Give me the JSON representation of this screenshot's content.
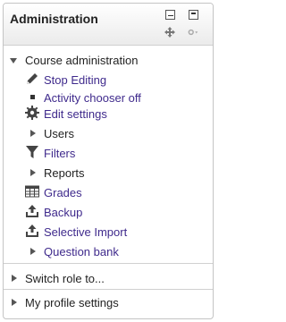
{
  "block": {
    "title": "Administration",
    "header_icons": [
      "minimize-icon",
      "dock-icon",
      "move-icon",
      "gear-icon"
    ]
  },
  "course_admin": {
    "label": "Course administration",
    "items": [
      {
        "label": "Stop Editing",
        "icon": "pencil-icon",
        "type": "link"
      },
      {
        "label": "Activity chooser off",
        "icon": "bullet-icon",
        "type": "link"
      },
      {
        "label": "Edit settings",
        "icon": "gear-icon",
        "type": "link"
      },
      {
        "label": "Users",
        "icon": "expand-arrow-icon",
        "type": "branch"
      },
      {
        "label": "Filters",
        "icon": "filter-icon",
        "type": "link"
      },
      {
        "label": "Reports",
        "icon": "expand-arrow-icon",
        "type": "branch"
      },
      {
        "label": "Grades",
        "icon": "grades-table-icon",
        "type": "link"
      },
      {
        "label": "Backup",
        "icon": "backup-upload-icon",
        "type": "link"
      },
      {
        "label": "Selective Import",
        "icon": "import-upload-icon",
        "type": "link"
      },
      {
        "label": "Question bank",
        "icon": "expand-arrow-icon",
        "type": "branch-link"
      }
    ]
  },
  "switch_role": {
    "label": "Switch role to..."
  },
  "profile_settings": {
    "label": "My profile settings"
  }
}
